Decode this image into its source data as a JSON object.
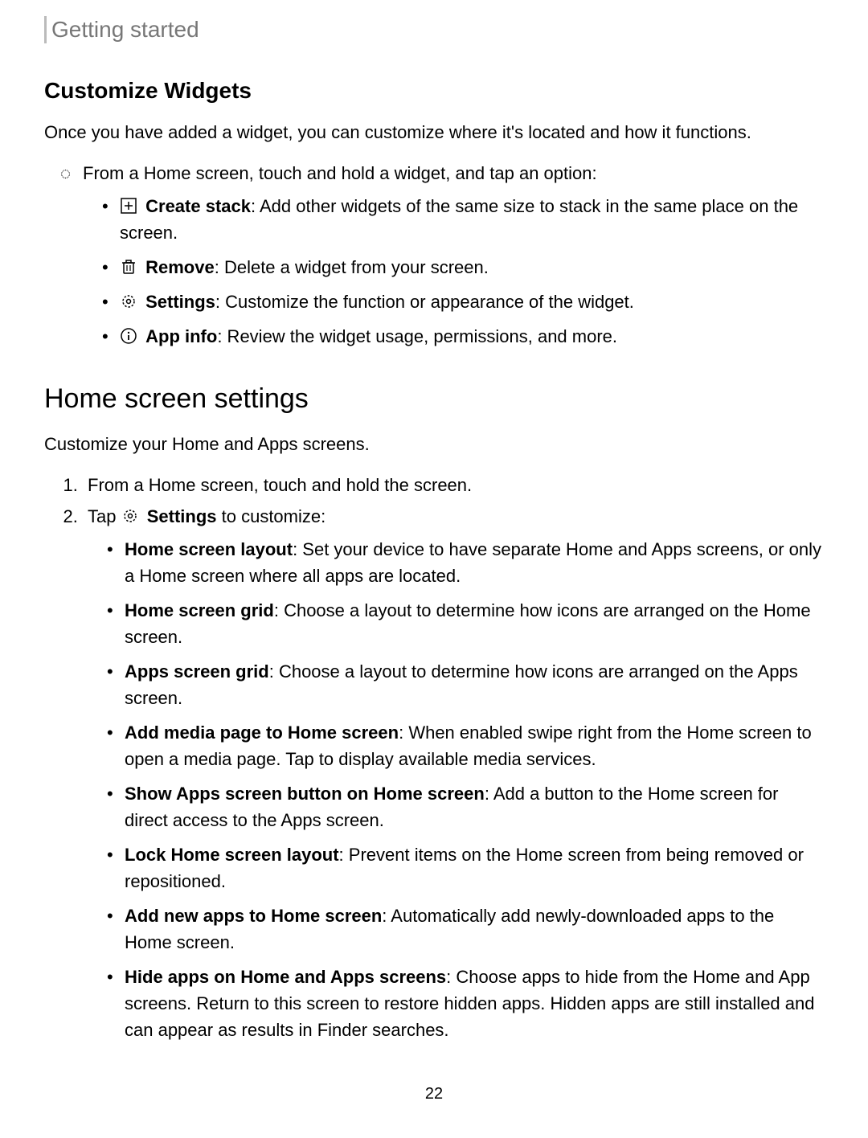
{
  "header": "Getting started",
  "customize": {
    "title": "Customize Widgets",
    "intro": "Once you have added a widget, you can customize where it's located and how it functions.",
    "lead": "From a Home screen, touch and hold a widget, and tap an option:",
    "items": [
      {
        "icon": "plus-box-icon",
        "label": "Create stack",
        "desc": ": Add other widgets of the same size to stack in the same place on the screen."
      },
      {
        "icon": "trash-icon",
        "label": "Remove",
        "desc": ": Delete a widget from your screen."
      },
      {
        "icon": "gear-icon",
        "label": "Settings",
        "desc": ": Customize the function or appearance of the widget."
      },
      {
        "icon": "info-icon",
        "label": "App info",
        "desc": ": Review the widget usage, permissions, and more."
      }
    ]
  },
  "home": {
    "title": "Home screen settings",
    "intro": "Customize your Home and Apps screens.",
    "step1": "From a Home screen, touch and hold the screen.",
    "step2_pre": "Tap ",
    "step2_label": "Settings",
    "step2_post": " to customize:",
    "items": [
      {
        "label": "Home screen layout",
        "desc": ": Set your device to have separate Home and Apps screens, or only a Home screen where all apps are located."
      },
      {
        "label": "Home screen grid",
        "desc": ": Choose a layout to determine how icons are arranged on the Home screen."
      },
      {
        "label": "Apps screen grid",
        "desc": ": Choose a layout to determine how icons are arranged on the Apps screen."
      },
      {
        "label": "Add media page to Home screen",
        "desc": ": When enabled swipe right from the Home screen to open a media page. Tap to display available media services."
      },
      {
        "label": "Show Apps screen button on Home screen",
        "desc": ": Add a button to the Home screen for direct access to the Apps screen."
      },
      {
        "label": "Lock Home screen layout",
        "desc": ": Prevent items on the Home screen from being removed or repositioned."
      },
      {
        "label": "Add new apps to Home screen",
        "desc": ": Automatically add newly-downloaded apps to the Home screen."
      },
      {
        "label": "Hide apps on Home and Apps screens",
        "desc": ": Choose apps to hide from the Home and App screens. Return to this screen to restore hidden apps. Hidden apps are still installed and can appear as results in Finder searches."
      }
    ]
  },
  "page_number": "22"
}
